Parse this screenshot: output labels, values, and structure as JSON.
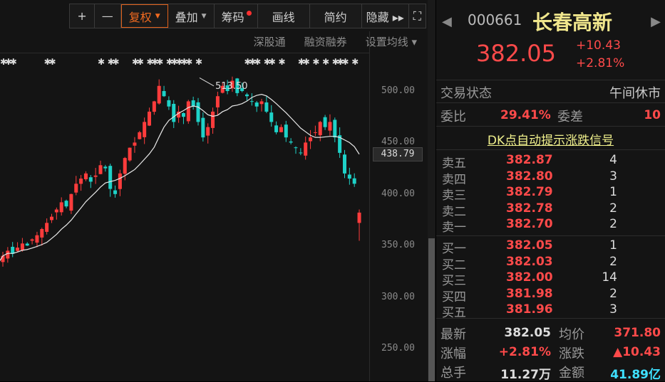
{
  "toolbar": {
    "plus": "+",
    "minus": "—",
    "fuquan": "复权",
    "diejia": "叠加",
    "chouma": "筹码",
    "huaxian": "画线",
    "jianyue": "简约",
    "yincang": "隐藏 ▸▸",
    "fullscreen": "⛶"
  },
  "subbar": {
    "shengutong": "深股通",
    "rongzi": "融资融券",
    "junxian": "设置均线 ▾"
  },
  "chart_data": {
    "type": "candlestick",
    "y_ticks": [
      "500.00",
      "450.00",
      "400.00",
      "350.00",
      "300.00",
      "250.00"
    ],
    "y_tick_values": [
      500,
      450,
      400,
      350,
      300,
      250
    ],
    "current_label": "438.79",
    "current_value": 438.79,
    "high_annotation": "513.50",
    "high_value": 513.5,
    "closes": [
      340,
      345,
      342,
      348,
      352,
      350,
      356,
      360,
      366,
      372,
      378,
      385,
      392,
      388,
      400,
      410,
      415,
      420,
      412,
      418,
      428,
      425,
      405,
      400,
      420,
      435,
      445,
      450,
      460,
      470,
      480,
      490,
      505,
      495,
      485,
      470,
      480,
      475,
      490,
      485,
      470,
      455,
      465,
      480,
      495,
      505,
      500,
      510,
      498,
      500,
      495,
      490,
      485,
      490,
      480,
      470,
      460,
      465,
      455,
      450,
      445,
      440,
      450,
      455,
      460,
      470,
      465,
      470,
      455,
      440,
      420,
      415,
      410,
      382
    ],
    "colors": {
      "up": "#ff3c3c",
      "down": "#1ed2c8",
      "ma": "#e8e8e8"
    }
  },
  "quote": {
    "code": "000661",
    "name": "长春高新",
    "price": "382.05",
    "change": "+10.43",
    "change_pct": "+2.81%"
  },
  "status": {
    "label": "交易状态",
    "value": "午间休市"
  },
  "weibi": {
    "label": "委比",
    "value": "29.41%",
    "diff_label": "委差",
    "diff": "10"
  },
  "dk_link": "DK点自动提示涨跌信号",
  "asks": [
    {
      "k": "卖五",
      "p": "382.87",
      "v": "4"
    },
    {
      "k": "卖四",
      "p": "382.80",
      "v": "3"
    },
    {
      "k": "卖三",
      "p": "382.79",
      "v": "1"
    },
    {
      "k": "卖二",
      "p": "382.78",
      "v": "2"
    },
    {
      "k": "卖一",
      "p": "382.70",
      "v": "2"
    }
  ],
  "bids": [
    {
      "k": "买一",
      "p": "382.05",
      "v": "1"
    },
    {
      "k": "买二",
      "p": "382.03",
      "v": "2"
    },
    {
      "k": "买三",
      "p": "382.00",
      "v": "14"
    },
    {
      "k": "买四",
      "p": "381.98",
      "v": "2"
    },
    {
      "k": "买五",
      "p": "381.96",
      "v": "3"
    }
  ],
  "stats": {
    "latest_l": "最新",
    "latest": "382.05",
    "avg_l": "均价",
    "avg": "371.80",
    "pct_l": "涨幅",
    "pct": "+2.81%",
    "chg_l": "涨跌",
    "chg": "▲10.43",
    "vol_l": "总手",
    "vol": "11.27万",
    "amt_l": "金额",
    "amt": "41.89亿"
  }
}
